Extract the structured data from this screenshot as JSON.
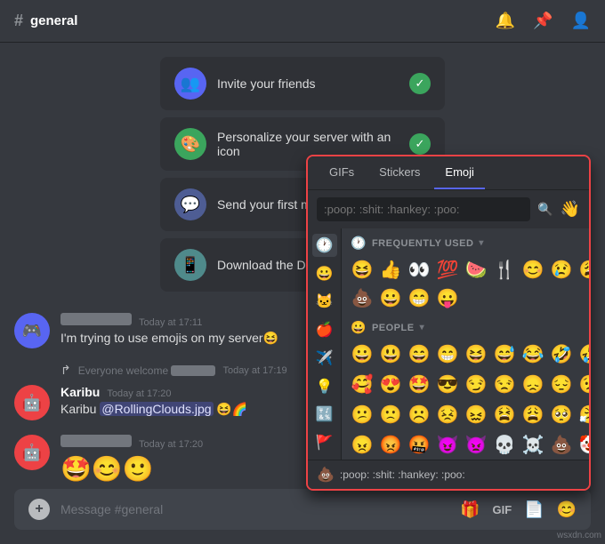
{
  "header": {
    "channel_icon": "#",
    "channel_name": "general",
    "icons": [
      "bell-icon",
      "pin-icon",
      "members-icon"
    ]
  },
  "checklist": {
    "items": [
      {
        "label": "Invite your friends",
        "icon": "👥",
        "color": "purple",
        "checked": true
      },
      {
        "label": "Personalize your server with an icon",
        "icon": "🎨",
        "color": "green",
        "checked": true
      },
      {
        "label": "Send your first message",
        "icon": "💬",
        "color": "blue",
        "checked": true
      },
      {
        "label": "Download the Discord A...",
        "icon": "📱",
        "color": "teal",
        "checked": false
      }
    ]
  },
  "messages": [
    {
      "avatar": "discord",
      "username_blurred": true,
      "timestamp": "Today at 17:11",
      "text": "I'm trying to use emojis on my server😆",
      "has_reply": false
    },
    {
      "is_reply": true,
      "reply_text": "Everyone welcome",
      "reply_extra": "",
      "timestamp": "Today at 17:19"
    },
    {
      "avatar": "red",
      "username": "Karibu",
      "timestamp": "Today at 17:20",
      "text": "Karibu @RollingClouds.jpg 😆🌈",
      "has_mention": true
    },
    {
      "avatar": "red",
      "username_blurred": true,
      "timestamp": "Today at 17:20",
      "text": "🤩😊🙂",
      "extra_emoji": true
    }
  ],
  "input": {
    "placeholder": "Message #general",
    "icons": [
      "gift-icon",
      "gif-icon",
      "sticker-icon",
      "emoji-icon"
    ]
  },
  "emoji_picker": {
    "tabs": [
      "GIFs",
      "Stickers",
      "Emoji"
    ],
    "active_tab": "Emoji",
    "search_placeholder": ":poop: :shit: :hankey: :poo:",
    "frequently_used": {
      "label": "FREQUENTLY USED",
      "emojis": [
        "😆",
        "👍",
        "👀",
        "💯",
        "🍉",
        "🍴",
        "😊",
        "😢",
        "😩"
      ]
    },
    "frequently_used_row2": [
      "💩",
      "😀",
      "😁",
      "😛"
    ],
    "people": {
      "label": "PEOPLE",
      "rows": [
        [
          "😀",
          "😃",
          "😄",
          "😁",
          "😆",
          "😅",
          "😂",
          "🤣",
          "🤣"
        ],
        [
          "🥰",
          "😍",
          "🤩",
          "😎",
          "😏",
          "😒",
          "😞",
          "😔",
          "😟"
        ],
        [
          "😕",
          "🙁",
          "☹️",
          "😣",
          "😖",
          "😫",
          "😩",
          "🥺",
          "😤"
        ],
        [
          "😠",
          "😡",
          "🤬",
          "😈",
          "👿",
          "💀",
          "☠️",
          "💩",
          "🤡"
        ]
      ]
    },
    "footer_emoji": "💩",
    "footer_text": ":poop: :shit: :hankey: :poo:",
    "sidebar_icons": [
      "🕐",
      "😀",
      "🐱",
      "🍎",
      "✈️",
      "💡",
      "🔣",
      "🚩"
    ]
  }
}
